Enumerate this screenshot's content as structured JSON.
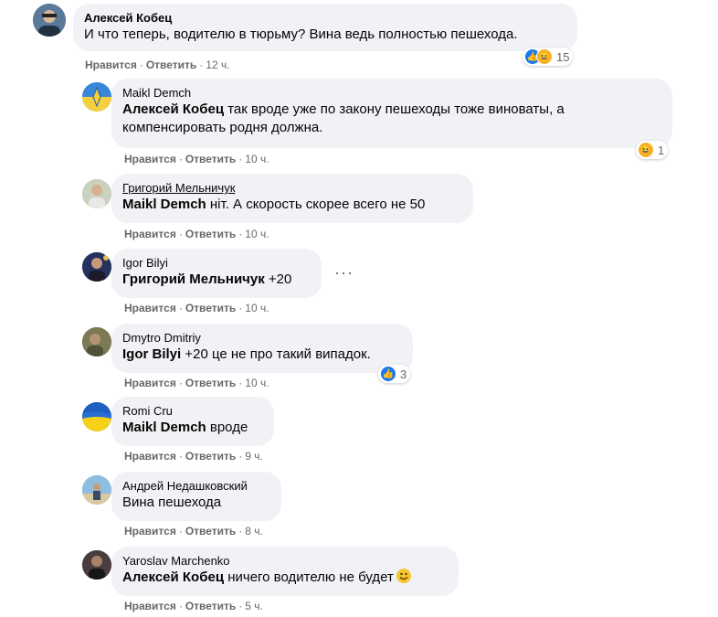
{
  "actions": {
    "like": "Нравится",
    "reply": "Ответить",
    "sep": "·"
  },
  "comments": [
    {
      "author": "Алексей Кобец",
      "mention": "",
      "text": "И что теперь, водителю в тюрьму? Вина ведь полностью пешехода.",
      "time": "12 ч.",
      "reactions": {
        "icons": [
          "like-icon",
          "haha-icon"
        ],
        "count": "15"
      },
      "avatar_color": "#4a6a8a"
    },
    {
      "author": "Maikl Demch",
      "mention": "Алексей Кобец",
      "text": " так вроде уже по закону пешеходы тоже виноваты, а",
      "text2": "компенсировать родня должна.",
      "time": "10 ч.",
      "reactions": {
        "icons": [
          "haha-icon"
        ],
        "count": "1"
      },
      "avatar_color": "#3d8fd6"
    },
    {
      "author": "Григорий Мельничук",
      "mention": "Maikl Demch",
      "text": " ніт. А скорость скорее всего не 50",
      "time": "10 ч.",
      "avatar_color": "#b7c4a8"
    },
    {
      "author": "Igor Bilyi",
      "mention": "Григорий Мельничук",
      "text": " +20",
      "time": "10 ч.",
      "avatar_color": "#2c3a6e"
    },
    {
      "author": "Dmytro Dmitriy",
      "mention": "Igor Bilyi",
      "text": " +20 це не про такий випадок.",
      "time": "10 ч.",
      "reactions": {
        "icons": [
          "like-icon"
        ],
        "count": "3"
      },
      "avatar_color": "#6b6a4a"
    },
    {
      "author": "Romi Cru",
      "mention": "Maikl Demch",
      "text": " вроде",
      "time": "9 ч.",
      "avatar_color": "#2f6fd0"
    },
    {
      "author": "Андрей Недашковский",
      "mention": "",
      "text": "Вина пешехода",
      "time": "8 ч.",
      "avatar_color": "#6aa0c8"
    },
    {
      "author": "Yaroslav Marchenko",
      "mention": "Алексей Кобец",
      "text": " ничего водителю не будет",
      "time": "5 ч.",
      "avatar_color": "#3a2f30"
    }
  ]
}
